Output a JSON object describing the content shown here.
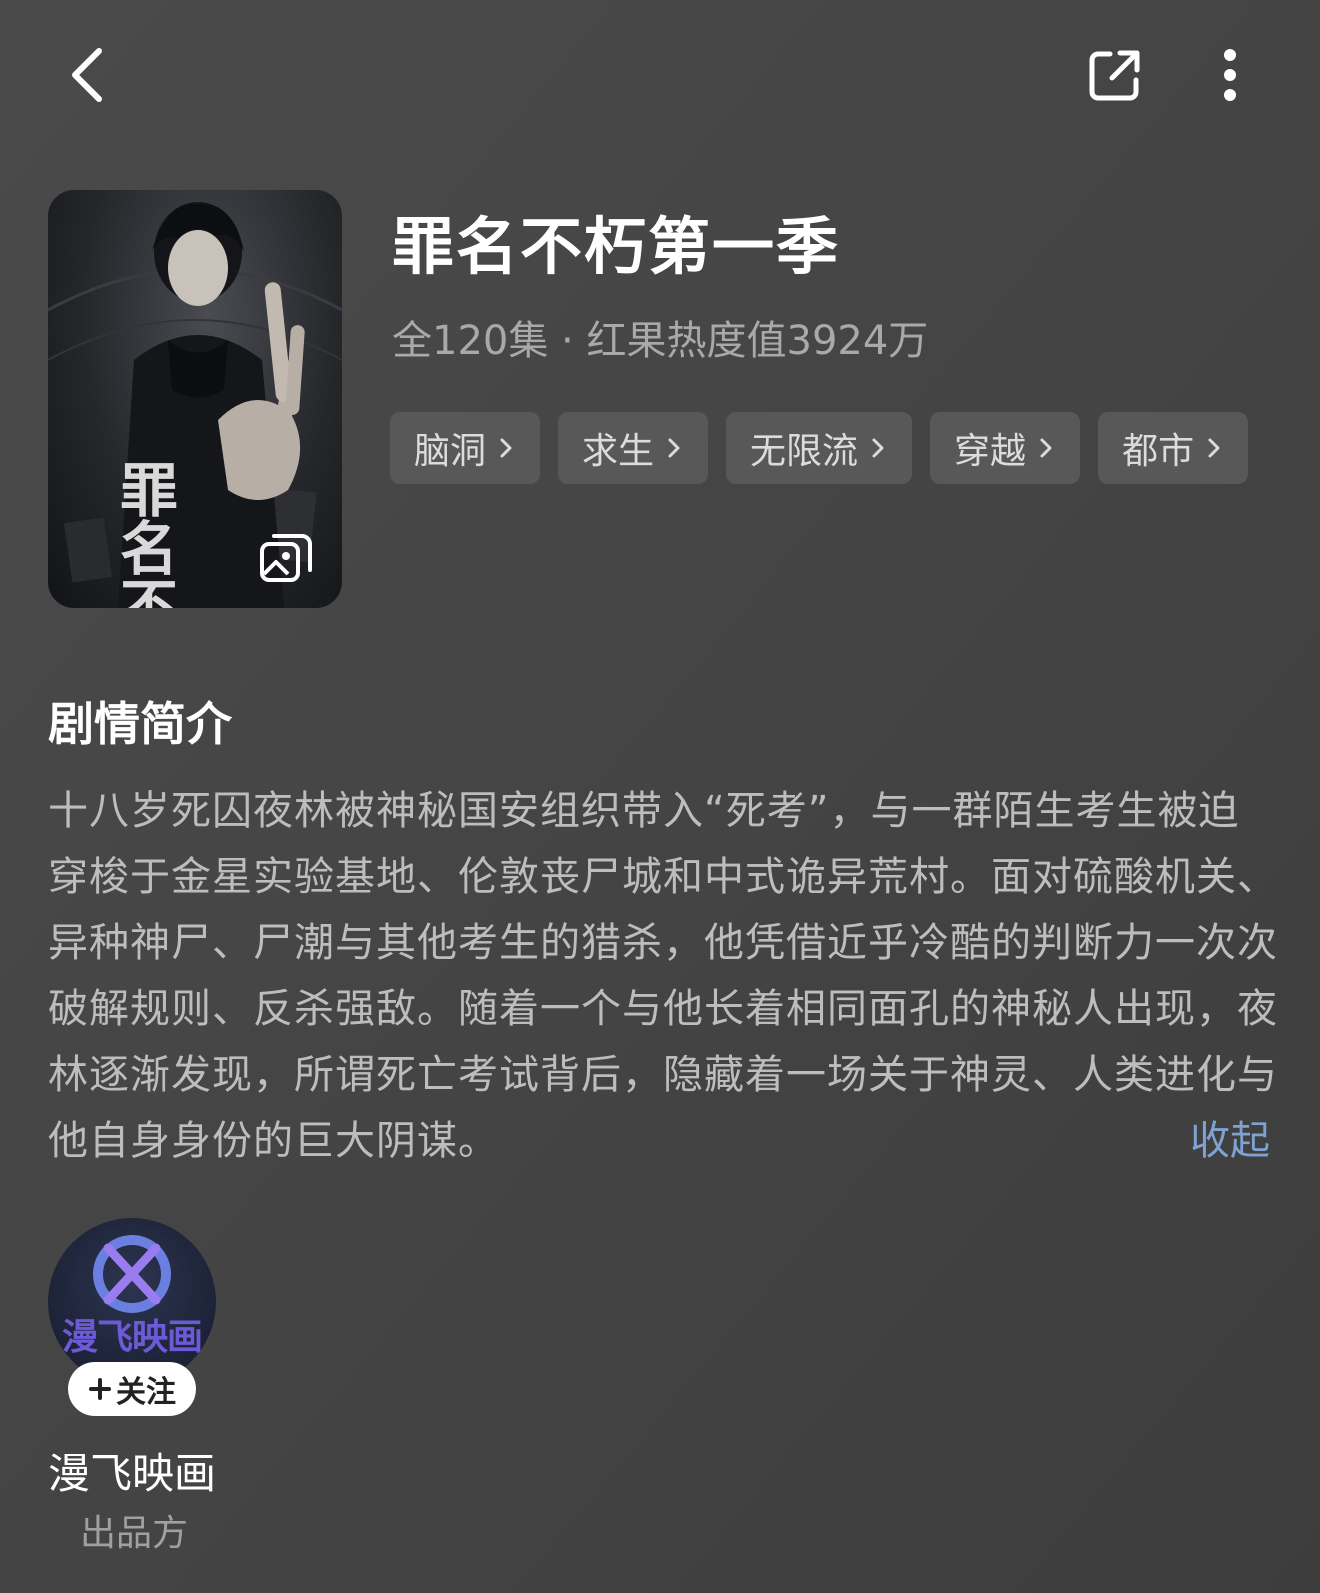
{
  "header": {
    "back_icon": "chevron-left-icon",
    "share_icon": "share-icon",
    "more_icon": "more-vertical-icon"
  },
  "drama": {
    "title": "罪名不朽第一季",
    "meta": "全120集 · 红果热度值3924万",
    "tags": [
      "脑洞",
      "求生",
      "无限流",
      "穿越",
      "都市"
    ],
    "poster_text": "罪名不朽",
    "poster_icon": "image-gallery-icon"
  },
  "synopsis": {
    "heading": "剧情简介",
    "text": "十八岁死囚夜林被神秘国安组织带入“死考”，与一群陌生考生被迫穿梭于金星实验基地、伦敦丧尸城和中式诡异荒村。面对硫酸机关、异种神尸、尸潮与其他考生的猎杀，他凭借近乎冷酷的判断力一次次破解规则、反杀强敌。随着一个与他长着相同面孔的神秘人出现，夜林逐渐发现，所谓死亡考试背后，隐藏着一场关于神灵、人类进化与他自身身份的巨大阴谋。",
    "collapse_label": "收起"
  },
  "producer": {
    "avatar_wordmark": "漫飞映画",
    "follow_label": "关注",
    "name": "漫飞映画",
    "role": "出品方"
  },
  "colors": {
    "background": "#454545",
    "tag_bg": "#585858",
    "link": "#7ea3d3"
  }
}
